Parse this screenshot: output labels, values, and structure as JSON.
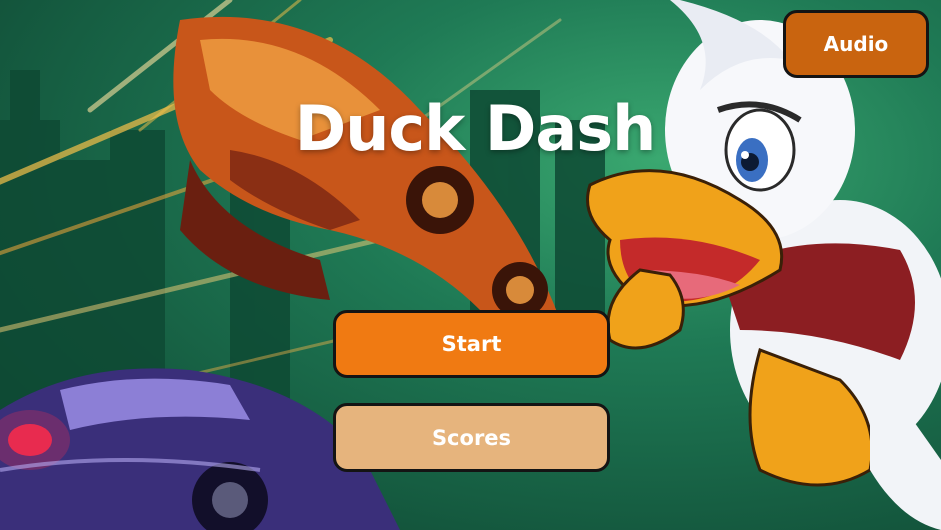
{
  "game": {
    "title": "Duck Dash"
  },
  "menu": {
    "start_label": "Start",
    "scores_label": "Scores",
    "audio_label": "Audio"
  },
  "colors": {
    "start_button": "#f07a12",
    "scores_button": "#e6b47d",
    "audio_button": "#c9640f",
    "button_border": "#141414",
    "title_text": "#ffffff"
  },
  "background": {
    "scene": "cartoon duck running from cars in a green city"
  }
}
